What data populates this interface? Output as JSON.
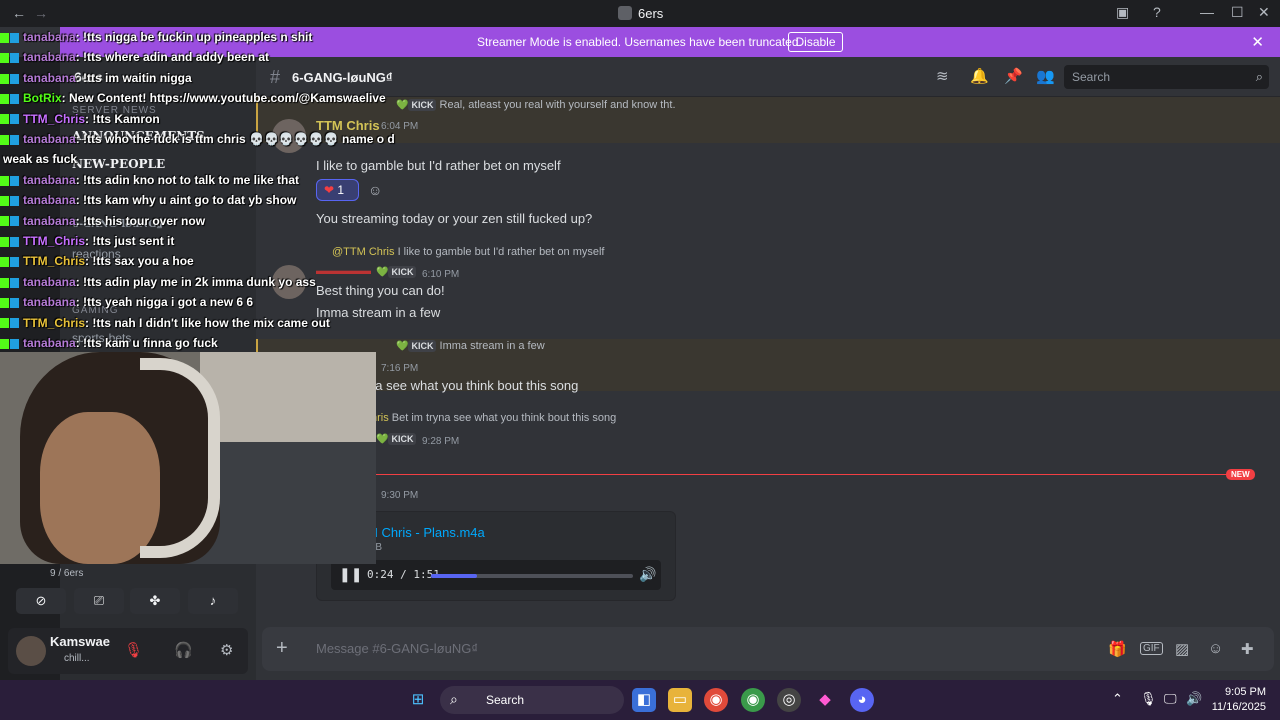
{
  "window": {
    "title": "6ers",
    "back": "←",
    "forward": "→"
  },
  "banner": {
    "text": "Streamer Mode is enabled. Usernames have been truncated.",
    "button": "Disable",
    "close": "✕"
  },
  "server": {
    "name": "6ers"
  },
  "channels": {
    "server_news": "SERVER NEWS",
    "announcements": "ANNOUNCEMENTS",
    "new_people": "NEW-PEOPLE",
    "gang_lounge": "6-GANG-løuNG₫",
    "reactions": "reactions",
    "gaming": "GAMING",
    "sports": "sports-bets"
  },
  "header": {
    "channel": "6-GANG-løuNG₫",
    "search_placeholder": "Search"
  },
  "messages": {
    "reply1": "Real, atleast you real with yourself and know tht.",
    "m1_user": "TTM Chris",
    "m1_time": "6:04 PM",
    "m1_line1": "I like to gamble but I'd rather bet on myself",
    "reaction_count": "1",
    "m1_line2": "You streaming today or your zen still fucked up?",
    "reply2_user": "@TTM Chris",
    "reply2_text": "I like to gamble but I'd rather bet on myself",
    "m2_time": "6:10 PM",
    "m2_line1": "Best thing you can do!",
    "m2_line2": "Imma stream in a few",
    "reply3_text": "Imma stream in a few",
    "m3_time": "7:16 PM",
    "m3_line1": "na see what you think bout this song",
    "reply4_user": "hris",
    "reply4_text": "Bet im tryna see what you think bout this song",
    "m4_time": "9:28 PM",
    "new_label": "NEW",
    "m5_time": "9:30 PM",
    "kick_label": "KICK"
  },
  "attachment": {
    "name": "M Chris - Plans.m4a",
    "size": "MB",
    "time": "0:24 / 1:51",
    "progress": 0.23
  },
  "composer": {
    "placeholder": "Message #6-GANG-løuNG₫"
  },
  "user": {
    "name": "Kamswae",
    "status": "chill..."
  },
  "voice": {
    "count": "9 / 6ers"
  },
  "overlay": {
    "lines": [
      {
        "user": "tanabana",
        "color": "#b57bd6",
        "text": ": !tts nigga be fuckin up pineapples n shit"
      },
      {
        "user": "tanabana",
        "color": "#b57bd6",
        "text": ": !tts where adin and addy been at"
      },
      {
        "user": "tanabana",
        "color": "#b57bd6",
        "text": ": !tts im waitin nigga"
      },
      {
        "user": "BotRix",
        "color": "#53fc18",
        "text": ": New Content! https://www.youtube.com/@Kamswaelive"
      },
      {
        "user": "TTM_Chris",
        "color": "#c770ff",
        "text": ": !tts Kamron"
      },
      {
        "user": "tanabana",
        "color": "#b57bd6",
        "text": ": !tts who the fuck is ttm chris 💀💀💀💀💀💀 name o d"
      },
      {
        "user": "",
        "color": "#ffffff",
        "text": "weak as fuck"
      },
      {
        "user": "tanabana",
        "color": "#b57bd6",
        "text": ": !tts adin kno not to talk to me like that"
      },
      {
        "user": "tanabana",
        "color": "#b57bd6",
        "text": ": !tts kam why u aint go to dat yb show"
      },
      {
        "user": "tanabana",
        "color": "#b57bd6",
        "text": ": !tts his tour over now"
      },
      {
        "user": "TTM_Chris",
        "color": "#c770ff",
        "text": ": !tts just sent it"
      },
      {
        "user": "TTM_Chris",
        "color": "#e8c23a",
        "text": ": !tts sax you a hoe"
      },
      {
        "user": "tanabana",
        "color": "#b57bd6",
        "text": ": !tts adin play me in 2k imma dunk yo ass"
      },
      {
        "user": "tanabana",
        "color": "#b57bd6",
        "text": ": !tts yeah nigga i got a new 6 6"
      },
      {
        "user": "TTM_Chris",
        "color": "#e8c23a",
        "text": ": !tts nah I didn't like how the mix came out"
      },
      {
        "user": "tanabana",
        "color": "#b57bd6",
        "text": ": !tts kam u finna go fuck"
      }
    ]
  },
  "taskbar": {
    "search": "Search",
    "time": "9:05 PM",
    "date": "11/16/2025"
  }
}
